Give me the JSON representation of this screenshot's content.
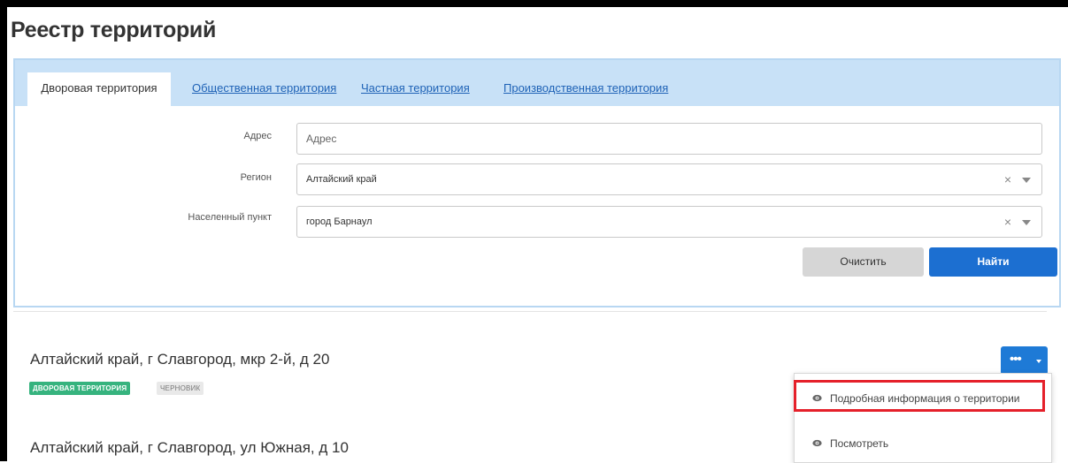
{
  "page": {
    "title": "Реестр территорий"
  },
  "tabs": [
    {
      "label": "Дворовая территория",
      "active": true
    },
    {
      "label": "Общественная территория",
      "active": false
    },
    {
      "label": "Частная территория",
      "active": false
    },
    {
      "label": "Производственная территория",
      "active": false
    }
  ],
  "filters": {
    "address": {
      "label": "Адрес",
      "placeholder": "Адрес",
      "value": ""
    },
    "region": {
      "label": "Регион",
      "value": "Алтайский край"
    },
    "locality": {
      "label": "Населенный пункт",
      "value": "город Барнаул"
    }
  },
  "buttons": {
    "clear": "Очистить",
    "find": "Найти"
  },
  "results": [
    {
      "title": "Алтайский край, г Славгород, мкр 2-й, д 20",
      "type_badge": "ДВОРОВАЯ ТЕРРИТОРИЯ",
      "status_badge": "ЧЕРНОВИК"
    },
    {
      "title": "Алтайский край, г Славгород, ул Южная, д 10"
    }
  ],
  "actions": {
    "button_label": "•••",
    "menu": [
      {
        "label": "Подробная информация о территории",
        "icon": "eye-icon",
        "highlighted": true
      },
      {
        "label": "Посмотреть",
        "icon": "eye-icon",
        "highlighted": false
      }
    ]
  },
  "colors": {
    "accent": "#1c6fd1",
    "tabs_bg": "#c8e1f7",
    "badge_type": "#36b37e",
    "highlight": "#e5202a"
  }
}
